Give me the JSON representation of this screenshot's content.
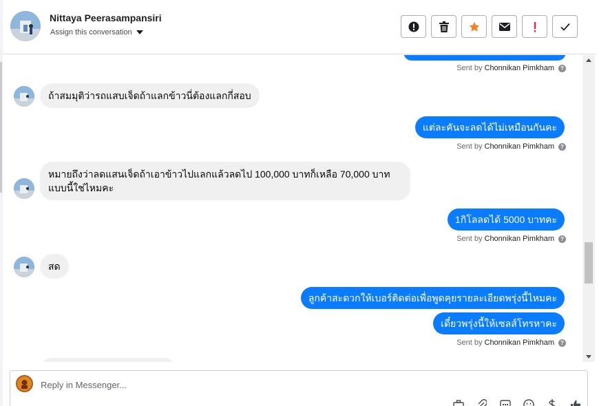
{
  "header": {
    "contact_name": "Nittaya Peerasampansiri",
    "assign_label": "Assign this conversation",
    "toolbar": [
      {
        "name": "mark-spam-button",
        "icon": "alert-circle-icon"
      },
      {
        "name": "delete-button",
        "icon": "trash-icon"
      },
      {
        "name": "star-button",
        "icon": "star-icon",
        "color": "#f5821f"
      },
      {
        "name": "mark-unread-button",
        "icon": "envelope-icon"
      },
      {
        "name": "follow-up-button",
        "icon": "exclamation-icon",
        "color": "#e41e3f"
      },
      {
        "name": "mark-done-button",
        "icon": "checkmark-icon"
      }
    ]
  },
  "thread": {
    "sender_name": "Chonnikan Pimkham",
    "sent_by_prefix": "Sent by",
    "help_glyph": "?",
    "messages": [
      {
        "dir": "out",
        "text": ""
      },
      {
        "dir": "in",
        "text": "ถ้าสมมุติว่ารถแสบเจ็ดถ้าแลกข้าวนี่ต้องแลกกี่สอบ"
      },
      {
        "dir": "out",
        "text": "แต่ละคันจะลดได้ไม่เหมือนกันคะ"
      },
      {
        "dir": "in",
        "text": "หมายถึงว่าลดแสนเจ็ดถ้าเอาข้าวไปแลกแล้วลดไป 100,000 บาทก็เหลือ 70,000 บาทแบบนี้ใช่ไหมคะ"
      },
      {
        "dir": "out",
        "text": "1กิโลลดได้ 5000 บาทคะ"
      },
      {
        "dir": "in",
        "text": "สด"
      },
      {
        "dir": "out",
        "text": "ลูกค้าสะดวกให้เบอร์ติดต่อเพื่อพูดคุยรายละเอียดพรุ่งนี้ไหมคะ"
      },
      {
        "dir": "out",
        "text": "เดี๋ยวพรุ่งนี้ให้เซลส์โทรหาคะ"
      },
      {
        "dir": "in",
        "text": ""
      }
    ]
  },
  "composer": {
    "placeholder": "Reply in Messenger...",
    "tools": [
      "briefcase-icon",
      "paperclip-icon",
      "gif-icon",
      "emoji-icon",
      "dollar-icon",
      "thumbs-up-icon"
    ]
  },
  "colors": {
    "outgoing_bubble": "#0a7cff",
    "incoming_bubble": "#f0f0f0",
    "star": "#f5821f",
    "follow_up": "#e41e3f"
  }
}
